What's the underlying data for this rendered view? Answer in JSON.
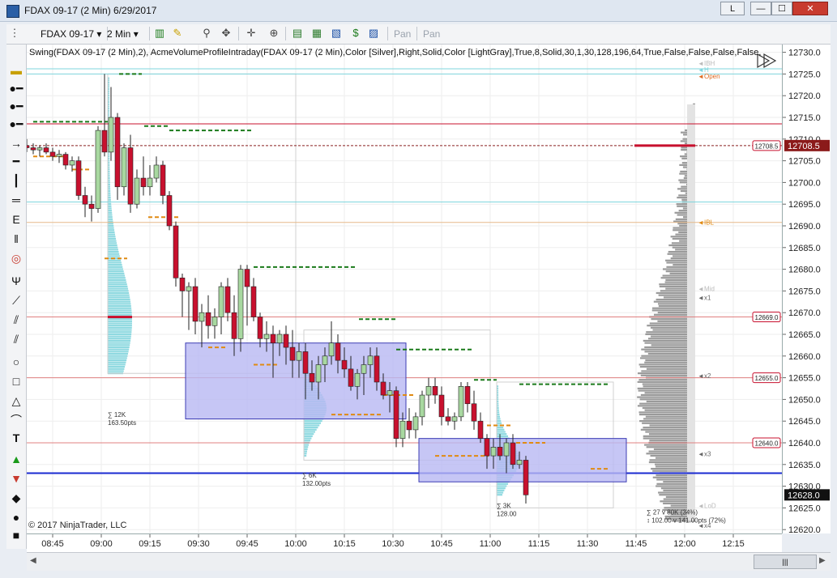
{
  "window": {
    "title": "FDAX 09-17 (2 Min)  6/29/2017",
    "link_button": "L",
    "min_label": "—",
    "max_label": "☐",
    "close_label": "✕"
  },
  "toolbar": {
    "instrument": "FDAX 09-17",
    "interval": "2 Min",
    "pan_label": "Pan",
    "pan2_label": "Pan"
  },
  "indicator_label": "Swing(FDAX 09-17 (2 Min),2), AcmeVolumeProfileIntraday(FDAX 09-17 (2 Min),Color [Silver],Right,Solid,Color [LightGray],True,8,Solid,30,1,30,128,196,64,True,False,False,False,False,",
  "copyright": "© 2017 NinjaTrader, LLC",
  "price_axis": {
    "ticks": [
      "12730.0",
      "12725.0",
      "12720.0",
      "12715.0",
      "12710.0",
      "12705.0",
      "12700.0",
      "12695.0",
      "12690.0",
      "12685.0",
      "12680.0",
      "12675.0",
      "12670.0",
      "12665.0",
      "12660.0",
      "12655.0",
      "12650.0",
      "12645.0",
      "12640.0",
      "12635.0",
      "12630.0",
      "12625.0",
      "12620.0"
    ],
    "current_price": "12708.5",
    "last_price": "12628.0"
  },
  "price_markers": [
    "12708.5",
    "12669.0",
    "12655.0",
    "12640.0"
  ],
  "profile_labels": {
    "ibh": "IBH",
    "h": "H",
    "open": "Open",
    "ibl": "IBL",
    "mid": "Mid",
    "x1": "x1",
    "x2": "x2",
    "x3": "x3",
    "lod": "LoD",
    "x4": "x4"
  },
  "cluster_labels": [
    {
      "a": "∑ 12K",
      "b": "163.50pts"
    },
    {
      "a": "∑ 6K",
      "b": "132.00pts"
    },
    {
      "a": "∑ 3K",
      "b": "128.00"
    },
    {
      "a": "∑ 27 v 80K (34%)",
      "b": "↕ 102.00 v 141.00pts (72%)"
    }
  ],
  "time_axis": [
    "08:45",
    "09:00",
    "09:15",
    "09:30",
    "09:45",
    "10:00",
    "10:15",
    "10:30",
    "10:45",
    "11:00",
    "11:15",
    "11:30",
    "11:45",
    "12:00",
    "12:15"
  ],
  "colors": {
    "up": "#a8d8a0",
    "down": "#c8102e",
    "box": "#b8b8f2",
    "box_border": "#3c3cb4",
    "blue_line": "#1a2ad0",
    "red_line": "#c8102e",
    "green_swing": "#1a7a1a",
    "orange_swing": "#e08a12",
    "volume": "#9a9a9a",
    "cyan_profile": "#8fd9e0"
  },
  "chart_data": {
    "type": "candlestick",
    "instrument": "FDAX 09-17",
    "interval": "2 Min",
    "date": "6/29/2017",
    "y_range": [
      12620,
      12732
    ],
    "candles": [
      {
        "t": "08:40",
        "o": 12708.5,
        "h": 12710,
        "l": 12707,
        "c": 12708
      },
      {
        "t": "08:42",
        "o": 12708,
        "h": 12709,
        "l": 12706.5,
        "c": 12707.5
      },
      {
        "t": "08:44",
        "o": 12707.5,
        "h": 12708.5,
        "l": 12706,
        "c": 12708
      },
      {
        "t": "08:46",
        "o": 12708,
        "h": 12709,
        "l": 12706.5,
        "c": 12707
      },
      {
        "t": "08:48",
        "o": 12707,
        "h": 12708,
        "l": 12705,
        "c": 12706
      },
      {
        "t": "08:50",
        "o": 12706,
        "h": 12707.5,
        "l": 12704.5,
        "c": 12706.5
      },
      {
        "t": "08:52",
        "o": 12706.5,
        "h": 12707,
        "l": 12703,
        "c": 12704
      },
      {
        "t": "08:54",
        "o": 12704,
        "h": 12706,
        "l": 12702.5,
        "c": 12705
      },
      {
        "t": "08:56",
        "o": 12705,
        "h": 12706,
        "l": 12696,
        "c": 12697
      },
      {
        "t": "08:58",
        "o": 12697,
        "h": 12699,
        "l": 12692,
        "c": 12695
      },
      {
        "t": "09:00",
        "o": 12695,
        "h": 12697,
        "l": 12691,
        "c": 12694
      },
      {
        "t": "09:02",
        "o": 12694,
        "h": 12713,
        "l": 12693,
        "c": 12712
      },
      {
        "t": "09:04",
        "o": 12712,
        "h": 12725,
        "l": 12706,
        "c": 12707
      },
      {
        "t": "09:06",
        "o": 12707,
        "h": 12722,
        "l": 12705,
        "c": 12715
      },
      {
        "t": "09:08",
        "o": 12715,
        "h": 12716,
        "l": 12696,
        "c": 12699
      },
      {
        "t": "09:10",
        "o": 12699,
        "h": 12709,
        "l": 12697,
        "c": 12708
      },
      {
        "t": "09:12",
        "o": 12708,
        "h": 12711,
        "l": 12693,
        "c": 12695
      },
      {
        "t": "09:14",
        "o": 12695,
        "h": 12703,
        "l": 12694,
        "c": 12701
      },
      {
        "t": "09:16",
        "o": 12701,
        "h": 12706,
        "l": 12697,
        "c": 12699
      },
      {
        "t": "09:18",
        "o": 12699,
        "h": 12704,
        "l": 12697,
        "c": 12701
      },
      {
        "t": "09:20",
        "o": 12701,
        "h": 12706,
        "l": 12700,
        "c": 12704
      },
      {
        "t": "09:22",
        "o": 12704,
        "h": 12705,
        "l": 12695,
        "c": 12697
      },
      {
        "t": "09:24",
        "o": 12697,
        "h": 12698,
        "l": 12689,
        "c": 12690
      },
      {
        "t": "09:26",
        "o": 12690,
        "h": 12691,
        "l": 12676,
        "c": 12678
      },
      {
        "t": "09:28",
        "o": 12678,
        "h": 12679,
        "l": 12669,
        "c": 12675
      },
      {
        "t": "09:30",
        "o": 12675,
        "h": 12677,
        "l": 12666,
        "c": 12676
      },
      {
        "t": "09:32",
        "o": 12676,
        "h": 12678,
        "l": 12665,
        "c": 12668
      },
      {
        "t": "09:34",
        "o": 12668,
        "h": 12672,
        "l": 12662,
        "c": 12670
      },
      {
        "t": "09:36",
        "o": 12670,
        "h": 12674,
        "l": 12664,
        "c": 12667
      },
      {
        "t": "09:38",
        "o": 12667,
        "h": 12671,
        "l": 12664,
        "c": 12669
      },
      {
        "t": "09:40",
        "o": 12669,
        "h": 12677,
        "l": 12665,
        "c": 12676
      },
      {
        "t": "09:42",
        "o": 12676,
        "h": 12678,
        "l": 12668,
        "c": 12670
      },
      {
        "t": "09:44",
        "o": 12670,
        "h": 12674,
        "l": 12660,
        "c": 12664
      },
      {
        "t": "09:46",
        "o": 12664,
        "h": 12681,
        "l": 12661,
        "c": 12680
      },
      {
        "t": "09:48",
        "o": 12680,
        "h": 12681,
        "l": 12667,
        "c": 12676
      },
      {
        "t": "09:50",
        "o": 12676,
        "h": 12678,
        "l": 12668,
        "c": 12669
      },
      {
        "t": "09:52",
        "o": 12669,
        "h": 12670,
        "l": 12662,
        "c": 12664
      },
      {
        "t": "09:54",
        "o": 12664,
        "h": 12668,
        "l": 12661,
        "c": 12665
      },
      {
        "t": "09:56",
        "o": 12665,
        "h": 12667,
        "l": 12655,
        "c": 12663
      },
      {
        "t": "09:58",
        "o": 12663,
        "h": 12666,
        "l": 12660,
        "c": 12665
      },
      {
        "t": "10:00",
        "o": 12665,
        "h": 12667,
        "l": 12658,
        "c": 12662
      },
      {
        "t": "10:02",
        "o": 12662,
        "h": 12666,
        "l": 12655,
        "c": 12659
      },
      {
        "t": "10:04",
        "o": 12659,
        "h": 12663,
        "l": 12655,
        "c": 12661
      },
      {
        "t": "10:06",
        "o": 12661,
        "h": 12663,
        "l": 12650,
        "c": 12656
      },
      {
        "t": "10:08",
        "o": 12656,
        "h": 12659,
        "l": 12652,
        "c": 12654
      },
      {
        "t": "10:10",
        "o": 12654,
        "h": 12660,
        "l": 12650,
        "c": 12658
      },
      {
        "t": "10:12",
        "o": 12658,
        "h": 12662,
        "l": 12654,
        "c": 12660
      },
      {
        "t": "10:14",
        "o": 12660,
        "h": 12668,
        "l": 12658,
        "c": 12663
      },
      {
        "t": "10:16",
        "o": 12663,
        "h": 12665,
        "l": 12656,
        "c": 12659
      },
      {
        "t": "10:18",
        "o": 12659,
        "h": 12662,
        "l": 12655,
        "c": 12657
      },
      {
        "t": "10:20",
        "o": 12657,
        "h": 12660,
        "l": 12652,
        "c": 12653
      },
      {
        "t": "10:22",
        "o": 12653,
        "h": 12657,
        "l": 12650,
        "c": 12656
      },
      {
        "t": "10:24",
        "o": 12656,
        "h": 12660,
        "l": 12651,
        "c": 12658
      },
      {
        "t": "10:26",
        "o": 12658,
        "h": 12662,
        "l": 12655,
        "c": 12660
      },
      {
        "t": "10:28",
        "o": 12660,
        "h": 12662,
        "l": 12652,
        "c": 12654
      },
      {
        "t": "10:30",
        "o": 12654,
        "h": 12656,
        "l": 12650,
        "c": 12651
      },
      {
        "t": "10:32",
        "o": 12651,
        "h": 12654,
        "l": 12647,
        "c": 12652
      },
      {
        "t": "10:34",
        "o": 12652,
        "h": 12653,
        "l": 12639,
        "c": 12641
      },
      {
        "t": "10:36",
        "o": 12641,
        "h": 12647,
        "l": 12639,
        "c": 12645
      },
      {
        "t": "10:38",
        "o": 12645,
        "h": 12648,
        "l": 12641,
        "c": 12643
      },
      {
        "t": "10:40",
        "o": 12643,
        "h": 12647,
        "l": 12641,
        "c": 12646
      },
      {
        "t": "10:42",
        "o": 12646,
        "h": 12652,
        "l": 12644,
        "c": 12651
      },
      {
        "t": "10:44",
        "o": 12651,
        "h": 12655,
        "l": 12648,
        "c": 12653
      },
      {
        "t": "10:46",
        "o": 12653,
        "h": 12655,
        "l": 12649,
        "c": 12651
      },
      {
        "t": "10:48",
        "o": 12651,
        "h": 12653,
        "l": 12644,
        "c": 12646
      },
      {
        "t": "10:50",
        "o": 12646,
        "h": 12648,
        "l": 12644,
        "c": 12645
      },
      {
        "t": "10:52",
        "o": 12645,
        "h": 12647,
        "l": 12643,
        "c": 12646
      },
      {
        "t": "10:54",
        "o": 12646,
        "h": 12654,
        "l": 12645,
        "c": 12653
      },
      {
        "t": "10:56",
        "o": 12653,
        "h": 12654,
        "l": 12647,
        "c": 12649
      },
      {
        "t": "10:58",
        "o": 12649,
        "h": 12652,
        "l": 12643,
        "c": 12645
      },
      {
        "t": "11:00",
        "o": 12645,
        "h": 12647,
        "l": 12640,
        "c": 12641
      },
      {
        "t": "11:02",
        "o": 12641,
        "h": 12642,
        "l": 12634,
        "c": 12637
      },
      {
        "t": "11:04",
        "o": 12637,
        "h": 12641,
        "l": 12634,
        "c": 12639
      },
      {
        "t": "11:06",
        "o": 12639,
        "h": 12642,
        "l": 12636,
        "c": 12637
      },
      {
        "t": "11:08",
        "o": 12637,
        "h": 12641,
        "l": 12633,
        "c": 12640
      },
      {
        "t": "11:10",
        "o": 12640,
        "h": 12642,
        "l": 12634,
        "c": 12635
      },
      {
        "t": "11:12",
        "o": 12635,
        "h": 12638,
        "l": 12634,
        "c": 12636
      },
      {
        "t": "11:14",
        "o": 12636,
        "h": 12637,
        "l": 12626,
        "c": 12628
      }
    ]
  }
}
